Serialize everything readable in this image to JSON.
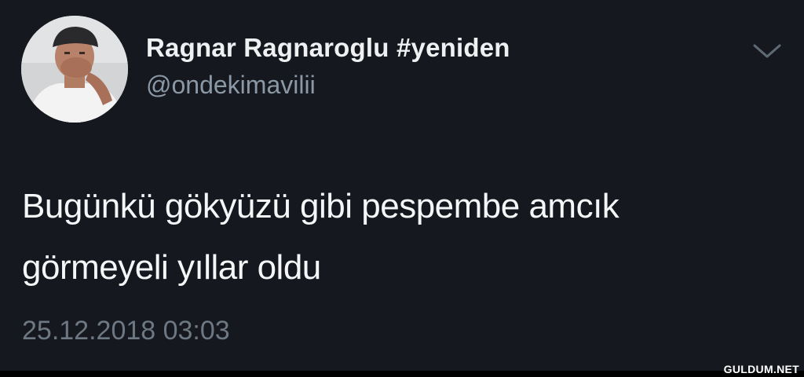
{
  "tweet": {
    "author": {
      "display_name": "Ragnar Ragnaroglu #yeniden",
      "handle": "@ondekimavilii",
      "avatar_icon": "profile-photo"
    },
    "menu_icon": "chevron-down-icon",
    "text_lines": [
      "Bugünkü gökyüzü gibi pespembe amcık",
      "görmeyeli yıllar oldu"
    ],
    "timestamp": "25.12.2018 03:03"
  },
  "watermark": "GULDUM.NET",
  "colors": {
    "background": "#15181e",
    "name": "#eef0f2",
    "handle": "#8b98a5",
    "timestamp": "#6e7883"
  }
}
